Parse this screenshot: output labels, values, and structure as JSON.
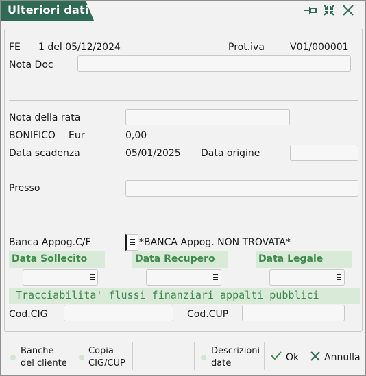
{
  "window": {
    "title": "Ulteriori dati"
  },
  "header": {
    "doc_type": "FE",
    "doc_number": "1 del 05/12/2024",
    "prot_label": "Prot.iva",
    "prot_value": "V01/000001"
  },
  "fields": {
    "nota_doc_label": "Nota Doc",
    "nota_rata_label": "Nota della rata",
    "payment_method": "BONIFICO",
    "currency": "Eur",
    "amount": "0,00",
    "data_scadenza_label": "Data scadenza",
    "data_scadenza_value": "05/01/2025",
    "data_origine_label": "Data origine",
    "presso_label": "Presso",
    "banca_label": "Banca Appog.C/F",
    "banca_status": "*BANCA Appog. NON TROVATA*"
  },
  "sections": {
    "sollecito": "Data Sollecito",
    "recupero": "Data Recupero",
    "legale": "Data Legale"
  },
  "tracciabilita": {
    "title": "Tracciabilita' flussi finanziari appalti pubblici",
    "cig_label": "Cod.CIG",
    "cup_label": "Cod.CUP"
  },
  "toolbar": {
    "banche_line1": "Banche",
    "banche_line2": "del cliente",
    "copia_line1": "Copia",
    "copia_line2": "CIG/CUP",
    "descr_line1": "Descrizioni",
    "descr_line2": "date",
    "ok": "Ok",
    "annulla": "Annulla"
  },
  "icons": {
    "pin": "pin-icon",
    "shrink": "shrink-icon",
    "close": "close-icon",
    "check": "check-icon",
    "cancel": "cancel-icon"
  },
  "colors": {
    "title_bg": "#2f6b54",
    "section_bg": "#d9ead9",
    "section_text": "#3d8a4a"
  }
}
